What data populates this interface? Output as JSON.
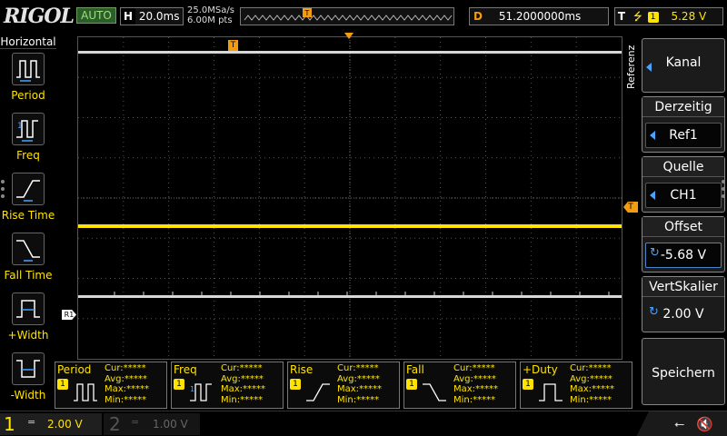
{
  "brand": "RIGOL",
  "run_status": "AUTO",
  "horizontal": {
    "label": "H",
    "scale": "20.0ms"
  },
  "sampling": {
    "rate": "25.0MSa/s",
    "points": "6.00M pts"
  },
  "delay": {
    "label": "D",
    "value": "51.2000000ms"
  },
  "trigger": {
    "label": "T",
    "edge_icon": "rising-edge-icon",
    "source": "1",
    "level": "5.28 V"
  },
  "left_menu": {
    "title": "Horizontal",
    "items": [
      {
        "label": "Period",
        "icon": "period-icon"
      },
      {
        "label": "Freq",
        "icon": "freq-icon"
      },
      {
        "label": "Rise Time",
        "icon": "rise-time-icon"
      },
      {
        "label": "Fall Time",
        "icon": "fall-time-icon"
      },
      {
        "label": "+Width",
        "icon": "pos-width-icon"
      },
      {
        "label": "-Width",
        "icon": "neg-width-icon"
      }
    ]
  },
  "right_menu": {
    "title": "Referenz",
    "kanal": "Kanal",
    "derzeitig": {
      "label": "Derzeitig",
      "value": "Ref1"
    },
    "quelle": {
      "label": "Quelle",
      "value": "CH1"
    },
    "offset": {
      "label": "Offset",
      "value": "-5.68 V"
    },
    "vertskalier": {
      "label": "VertSkalier",
      "value": "2.00 V"
    },
    "speichern": "Speichern"
  },
  "markers": {
    "trigger_pos": "T",
    "trigger_level": "T",
    "ref": "R1"
  },
  "measurements": [
    {
      "title": "Period",
      "channel": "1",
      "cur": "Cur:*****",
      "avg": "Avg:*****",
      "max": "Max:*****",
      "min": "Min:*****"
    },
    {
      "title": "Freq",
      "channel": "1",
      "cur": "Cur:*****",
      "avg": "Avg:*****",
      "max": "Max:*****",
      "min": "Min:*****"
    },
    {
      "title": "Rise",
      "channel": "1",
      "cur": "Cur:*****",
      "avg": "Avg:*****",
      "max": "Max:*****",
      "min": "Min:*****"
    },
    {
      "title": "Fall",
      "channel": "1",
      "cur": "Cur:*****",
      "avg": "Avg:*****",
      "max": "Max:*****",
      "min": "Min:*****"
    },
    {
      "title": "+Duty",
      "channel": "1",
      "cur": "Cur:*****",
      "avg": "Avg:*****",
      "max": "Max:*****",
      "min": "Min:*****"
    }
  ],
  "channels": [
    {
      "num": "1",
      "coupling": "=",
      "scale": "2.00 V"
    },
    {
      "num": "2",
      "coupling": "=",
      "scale": "1.00 V"
    }
  ],
  "colors": {
    "ch1": "#ffe400",
    "ref": "#d8d8d8",
    "accent": "#4aa3ff",
    "trigger": "#f39c12"
  }
}
